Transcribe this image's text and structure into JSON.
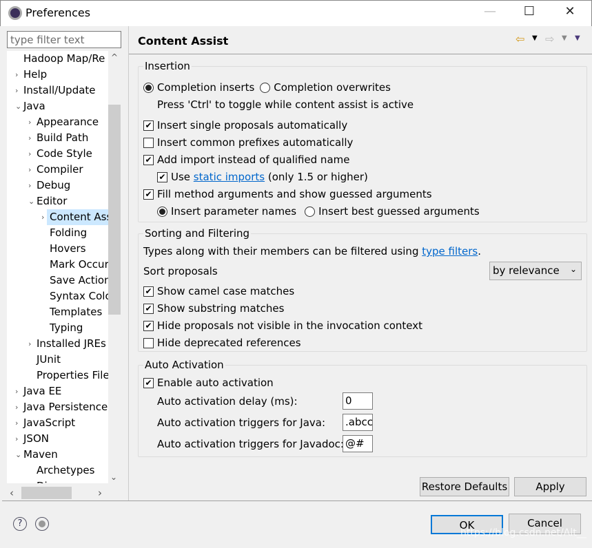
{
  "window": {
    "title": "Preferences",
    "minimize": "—",
    "maximize": "☐",
    "close": "✕"
  },
  "sidebar": {
    "filter_placeholder": "type filter text",
    "items": [
      {
        "label": "Hadoop Map/Re",
        "level": 0,
        "arrow": ""
      },
      {
        "label": "Help",
        "level": 0,
        "arrow": "›"
      },
      {
        "label": "Install/Update",
        "level": 0,
        "arrow": "›"
      },
      {
        "label": "Java",
        "level": 0,
        "arrow": "⌄"
      },
      {
        "label": "Appearance",
        "level": 1,
        "arrow": "›"
      },
      {
        "label": "Build Path",
        "level": 1,
        "arrow": "›"
      },
      {
        "label": "Code Style",
        "level": 1,
        "arrow": "›"
      },
      {
        "label": "Compiler",
        "level": 1,
        "arrow": "›"
      },
      {
        "label": "Debug",
        "level": 1,
        "arrow": "›"
      },
      {
        "label": "Editor",
        "level": 1,
        "arrow": "⌄"
      },
      {
        "label": "Content Assist",
        "level": 2,
        "arrow": "›",
        "selected": true
      },
      {
        "label": "Folding",
        "level": 2,
        "arrow": ""
      },
      {
        "label": "Hovers",
        "level": 2,
        "arrow": ""
      },
      {
        "label": "Mark Occurrences",
        "level": 2,
        "arrow": ""
      },
      {
        "label": "Save Actions",
        "level": 2,
        "arrow": ""
      },
      {
        "label": "Syntax Coloring",
        "level": 2,
        "arrow": ""
      },
      {
        "label": "Templates",
        "level": 2,
        "arrow": ""
      },
      {
        "label": "Typing",
        "level": 2,
        "arrow": ""
      },
      {
        "label": "Installed JREs",
        "level": 1,
        "arrow": "›"
      },
      {
        "label": "JUnit",
        "level": 1,
        "arrow": ""
      },
      {
        "label": "Properties Files Editor",
        "level": 1,
        "arrow": ""
      },
      {
        "label": "Java EE",
        "level": 0,
        "arrow": "›"
      },
      {
        "label": "Java Persistence",
        "level": 0,
        "arrow": "›"
      },
      {
        "label": "JavaScript",
        "level": 0,
        "arrow": "›"
      },
      {
        "label": "JSON",
        "level": 0,
        "arrow": "›"
      },
      {
        "label": "Maven",
        "level": 0,
        "arrow": "⌄"
      },
      {
        "label": "Archetypes",
        "level": 1,
        "arrow": ""
      },
      {
        "label": "Discovery",
        "level": 1,
        "arrow": ""
      }
    ]
  },
  "page": {
    "title": "Content Assist",
    "back_icon": "back-arrow-icon",
    "forward_icon": "forward-arrow-icon"
  },
  "insertion": {
    "label": "Insertion",
    "completion_inserts": {
      "label": "Completion inserts",
      "checked": true
    },
    "completion_overwrites": {
      "label": "Completion overwrites",
      "checked": false
    },
    "toggle_hint": "Press 'Ctrl' to toggle while content assist is active",
    "single_proposals": {
      "label": "Insert single proposals automatically",
      "checked": true
    },
    "common_prefixes": {
      "label": "Insert common prefixes automatically",
      "checked": false
    },
    "add_import": {
      "label": "Add import instead of qualified name",
      "checked": true
    },
    "static_imports": {
      "pre": "Use ",
      "link": "static imports",
      "post": " (only 1.5 or higher)",
      "checked": true
    },
    "fill_args": {
      "label": "Fill method arguments and show guessed arguments",
      "checked": true
    },
    "param_names": {
      "label": "Insert parameter names",
      "checked": true
    },
    "best_guessed": {
      "label": "Insert best guessed arguments",
      "checked": false
    }
  },
  "sorting": {
    "label": "Sorting and Filtering",
    "desc_pre": "Types along with their members can be filtered using ",
    "desc_link": "type filters",
    "desc_post": ".",
    "sort_label": "Sort proposals",
    "sort_value": "by relevance",
    "camel": {
      "label": "Show camel case matches",
      "checked": true
    },
    "substring": {
      "label": "Show substring matches",
      "checked": true
    },
    "hide_invisible": {
      "label": "Hide proposals not visible in the invocation context",
      "checked": true
    },
    "hide_deprecated": {
      "label": "Hide deprecated references",
      "checked": false
    }
  },
  "auto": {
    "label": "Auto Activation",
    "enable": {
      "label": "Enable auto activation",
      "checked": true
    },
    "delay_label": "Auto activation delay (ms):",
    "delay_value": "0",
    "java_label": "Auto activation triggers for Java:",
    "java_value": ".abcc",
    "javadoc_label": "Auto activation triggers for Javadoc:",
    "javadoc_value": "@#"
  },
  "buttons": {
    "restore": "Restore Defaults",
    "apply": "Apply",
    "ok": "OK",
    "cancel": "Cancel",
    "help": "?"
  },
  "watermark": "https://blog.csdn.net/Alt__"
}
